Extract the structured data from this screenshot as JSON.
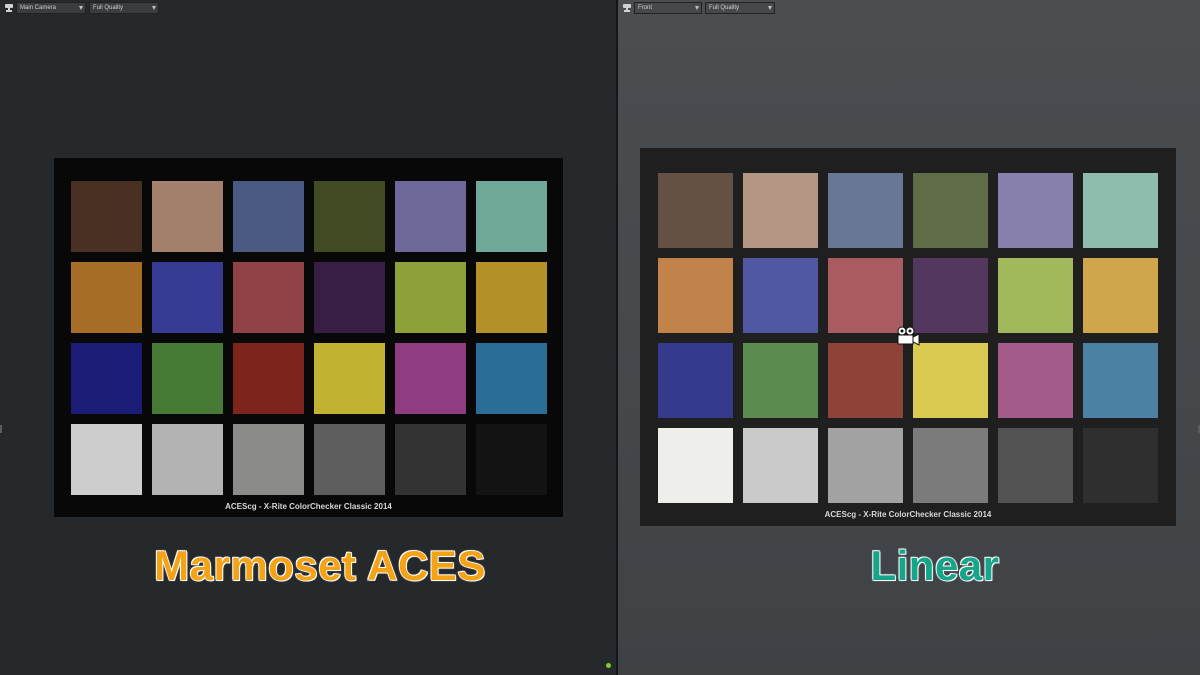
{
  "viewports": {
    "left": {
      "camera": "Main Camera",
      "quality": "Full Quality",
      "label": "Marmoset ACES",
      "label_color": "#f5a316",
      "caption": "ACEScg - X-Rite ColorChecker Classic 2014",
      "patches": [
        "#4a3023",
        "#a3806c",
        "#4b5a82",
        "#404b24",
        "#6e679a",
        "#70a89a",
        "#a86d26",
        "#373b93",
        "#8e4245",
        "#361e44",
        "#8da03a",
        "#b39128",
        "#1b1b78",
        "#477a34",
        "#7f241c",
        "#c1b232",
        "#8f3d80",
        "#2a6e98",
        "#cdcdcd",
        "#b3b3b3",
        "#8b8b89",
        "#5e5e5e",
        "#333333",
        "#131313"
      ]
    },
    "right": {
      "camera": "Front",
      "quality": "Full Quality",
      "label": "Linear",
      "label_color": "#14a58a",
      "caption": "ACEScg - X-Rite ColorChecker Classic 2014",
      "patches": [
        "#645143",
        "#b39684",
        "#697797",
        "#5f6c45",
        "#8780ac",
        "#8ebcad",
        "#c2834a",
        "#5058a4",
        "#a85c5f",
        "#53375f",
        "#a2b85c",
        "#cfa64c",
        "#363a8c",
        "#5c8c50",
        "#8f4338",
        "#dbca52",
        "#a45c8c",
        "#4b81a2",
        "#eeeeea",
        "#cacaca",
        "#a3a3a3",
        "#7b7b7b",
        "#525252",
        "#2f2f2f"
      ]
    }
  },
  "toolbar_icons": [
    "camera-icon",
    "gear-icon",
    "move-icon",
    "maximize-icon",
    "popout-icon"
  ],
  "status_color": "#7ed321"
}
